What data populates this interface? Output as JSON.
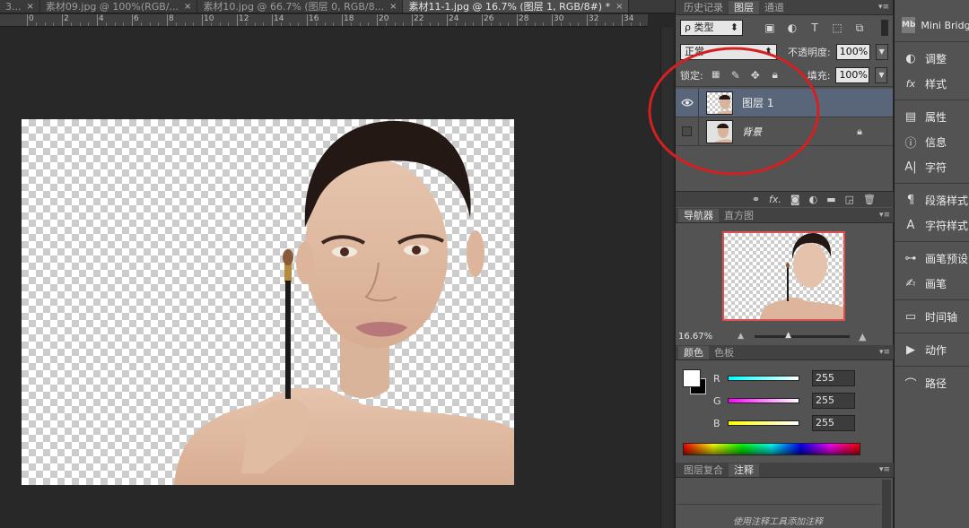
{
  "tabs": [
    {
      "label": "3...",
      "active": false
    },
    {
      "label": "素材09.jpg @ 100%(RGB/...",
      "active": false
    },
    {
      "label": "素材10.jpg @ 66.7% (图层 0, RGB/8...",
      "active": false
    },
    {
      "label": "素材11-1.jpg @ 16.7% (图层 1, RGB/8#) *",
      "active": true
    }
  ],
  "ruler_labels": [
    "0",
    "2",
    "4",
    "6",
    "8",
    "10",
    "12",
    "14",
    "16",
    "18",
    "20",
    "22",
    "24",
    "26",
    "28",
    "30",
    "32",
    "34"
  ],
  "layers_panel": {
    "tabs": [
      "历史记录",
      "图层",
      "通道"
    ],
    "filter_label": "ρ 类型",
    "blend_mode": "正常",
    "opacity_label": "不透明度:",
    "opacity_value": "100%",
    "lock_label": "锁定:",
    "fill_label": "填充:",
    "fill_value": "100%",
    "layers": [
      {
        "name": "图层 1",
        "selected": true
      },
      {
        "name": "背景",
        "selected": false,
        "locked": true
      }
    ]
  },
  "navigator_panel": {
    "tabs": [
      "导航器",
      "直方图"
    ],
    "zoom": "16.67%"
  },
  "color_panel": {
    "tabs": [
      "颜色",
      "色板"
    ],
    "channels": [
      {
        "label": "R",
        "value": "255"
      },
      {
        "label": "G",
        "value": "255"
      },
      {
        "label": "B",
        "value": "255"
      }
    ]
  },
  "notes_panel": {
    "tabs": [
      "图层复合",
      "注释"
    ],
    "hint": "使用注释工具添加注释"
  },
  "dock": [
    {
      "label": "Mini Bridge",
      "icon": "mini-bridge-icon"
    },
    {
      "label": "调整",
      "icon": "adjustments-icon"
    },
    {
      "label": "样式",
      "icon": "styles-icon"
    },
    {
      "label": "属性",
      "icon": "properties-icon"
    },
    {
      "label": "信息",
      "icon": "info-icon"
    },
    {
      "label": "字符",
      "icon": "character-icon"
    },
    {
      "label": "段落样式",
      "icon": "paragraph-styles-icon"
    },
    {
      "label": "字符样式",
      "icon": "character-styles-icon"
    },
    {
      "label": "画笔预设",
      "icon": "brush-presets-icon"
    },
    {
      "label": "画笔",
      "icon": "brush-icon"
    },
    {
      "label": "时间轴",
      "icon": "timeline-icon"
    },
    {
      "label": "动作",
      "icon": "actions-icon"
    },
    {
      "label": "路径",
      "icon": "paths-icon"
    }
  ],
  "colors": {
    "highlight_circle": "#d42020",
    "selected_layer": "#59667a",
    "panel_bg": "#535353"
  }
}
